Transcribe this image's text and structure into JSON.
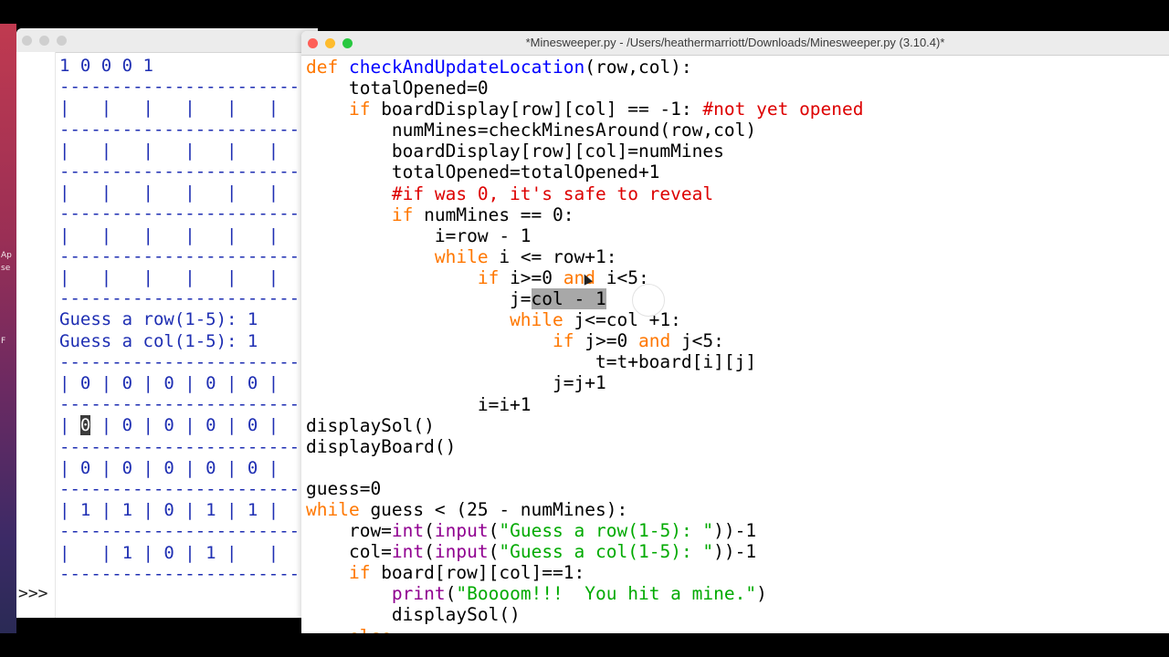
{
  "desktop": {
    "side_text": [
      "Ap",
      "se",
      "F"
    ]
  },
  "shell": {
    "output_lines": [
      "1 0 0 0 1",
      "-----------------------",
      "|   |   |   |   |   |",
      "-----------------------",
      "|   |   |   |   |   |",
      "-----------------------",
      "|   |   |   |   |   |",
      "-----------------------",
      "|   |   |   |   |   |",
      "-----------------------",
      "|   |   |   |   |   |",
      "-----------------------",
      "Guess a row(1-5): 1",
      "Guess a col(1-5): 1",
      "-----------------------",
      "| 0 | 0 | 0 | 0 | 0 |",
      "-----------------------",
      "| ",
      "0",
      " | 0 | 0 | 0 | 0 |",
      "-----------------------",
      "| 0 | 0 | 0 | 0 | 0 |",
      "-----------------------",
      "| 1 | 1 | 0 | 1 | 1 |",
      "-----------------------",
      "|   | 1 | 0 | 1 |   |",
      "-----------------------"
    ],
    "prompt": ">>>"
  },
  "editor": {
    "title": "*Minesweeper.py - /Users/heathermarriott/Downloads/Minesweeper.py (3.10.4)*"
  }
}
